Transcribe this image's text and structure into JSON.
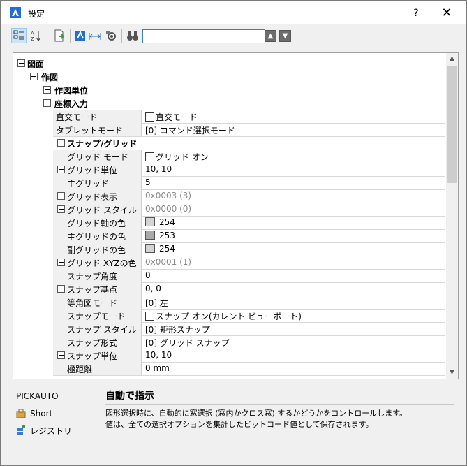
{
  "window": {
    "title": "設定",
    "help": "?",
    "close": "✕"
  },
  "search": {
    "value": "",
    "placeholder": ""
  },
  "tree": {
    "root": "図面",
    "drawing": "作図",
    "units": "作図単位",
    "coord": "座標入力"
  },
  "props": {
    "ortho": {
      "name": "直交モード",
      "value": "直交モード"
    },
    "tablet": {
      "name": "タブレットモード",
      "value": "[0] コマンド選択モード"
    },
    "snapgrid": "スナップ/グリッド",
    "gridmode": {
      "name": "グリッド モード",
      "value": "グリッド オン"
    },
    "gridunit": {
      "name": "グリッド単位",
      "value": "10, 10"
    },
    "majorgrid": {
      "name": "主グリッド",
      "value": "5"
    },
    "griddisp": {
      "name": "グリッド表示",
      "value": "0x0003 (3)"
    },
    "gridstyle": {
      "name": "グリッド スタイル",
      "value": "0x0000 (0)"
    },
    "gridaxis": {
      "name": "グリッド軸の色",
      "value": "254"
    },
    "majorcolor": {
      "name": "主グリッドの色",
      "value": "253"
    },
    "minorcolor": {
      "name": "副グリッドの色",
      "value": "254"
    },
    "gridxyz": {
      "name": "グリッド XYZの色",
      "value": "0x0001 (1)"
    },
    "snapangle": {
      "name": "スナップ角度",
      "value": "0"
    },
    "snapbase": {
      "name": "スナップ基点",
      "value": "0, 0"
    },
    "isomode": {
      "name": "等角図モード",
      "value": "[0] 左"
    },
    "snapmode": {
      "name": "スナップモード",
      "value": "スナップ オン(カレント ビューポート)"
    },
    "snapstyle": {
      "name": "スナップ スタイル",
      "value": "[0] 矩形スナップ"
    },
    "snaptype": {
      "name": "スナップ形式",
      "value": "[0] グリッド スナップ"
    },
    "snapunit": {
      "name": "スナップ単位",
      "value": "10, 10"
    },
    "polar": {
      "name": "極距離",
      "value": "0 mm"
    }
  },
  "bottom": {
    "command": "PICKAUTO",
    "short": "Short",
    "registry": "レジストリ",
    "desc_title": "自動で指示",
    "desc_line1": "図形選択時に、自動的に窓選択 (窓内かクロス窓) するかどうかをコントロールします。",
    "desc_line2": "値は、全ての選択オプションを集計したビットコード値として保存されます。"
  },
  "colors": {
    "accent": "#1f6fd6",
    "search_border": "#3c7fb1",
    "gray_value": "#8a8a8a"
  }
}
